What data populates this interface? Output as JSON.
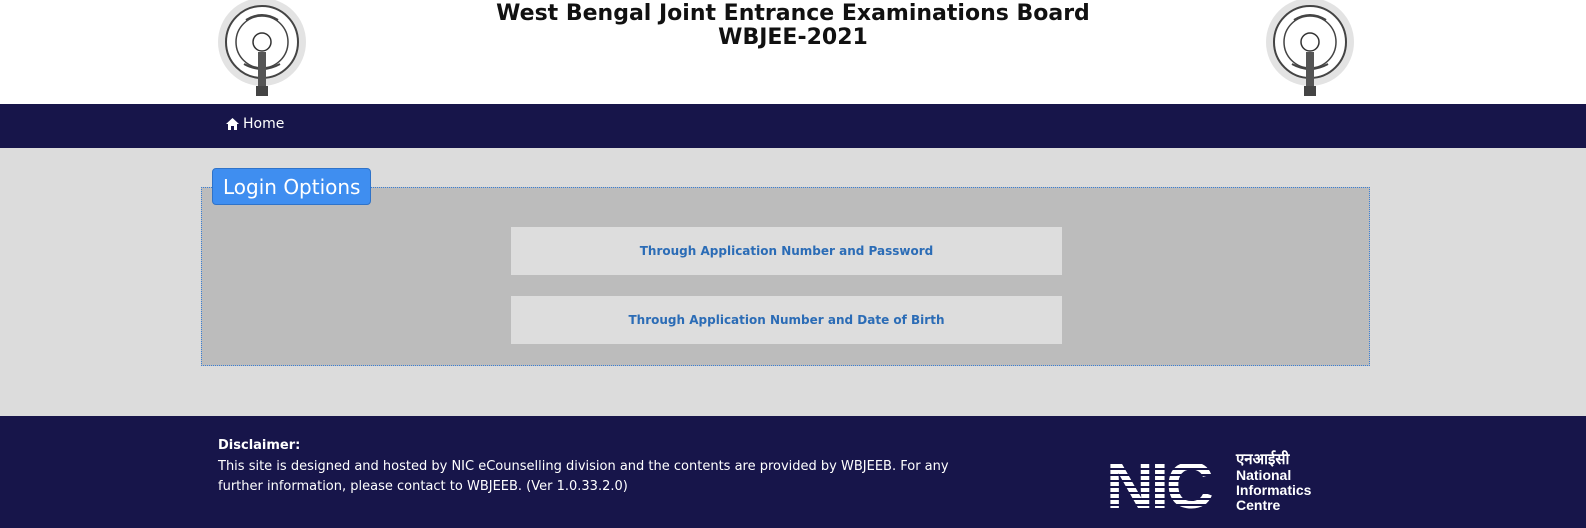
{
  "header": {
    "title_line1": "West Bengal Joint Entrance Examinations Board",
    "title_line2": "WBJEE-2021"
  },
  "nav": {
    "home_label": "Home"
  },
  "login": {
    "legend": "Login Options",
    "option1": "Through Application Number and Password",
    "option2": "Through Application Number and Date of Birth"
  },
  "footer": {
    "disclaimer_title": "Disclaimer:",
    "disclaimer_text": "This site is designed and hosted by NIC eCounselling division and the contents are provided by WBJEEB. For any further information, please contact to WBJEEB. (Ver 1.0.33.2.0)",
    "nic_hindi": "एनआईसी",
    "nic_name_line1": "National",
    "nic_name_line2": "Informatics",
    "nic_name_line3": "Centre",
    "nic_letters": "NIC"
  },
  "colors": {
    "navy": "#17154a",
    "legend_blue": "#3f8ef0",
    "link_blue": "#2b6cb6"
  }
}
